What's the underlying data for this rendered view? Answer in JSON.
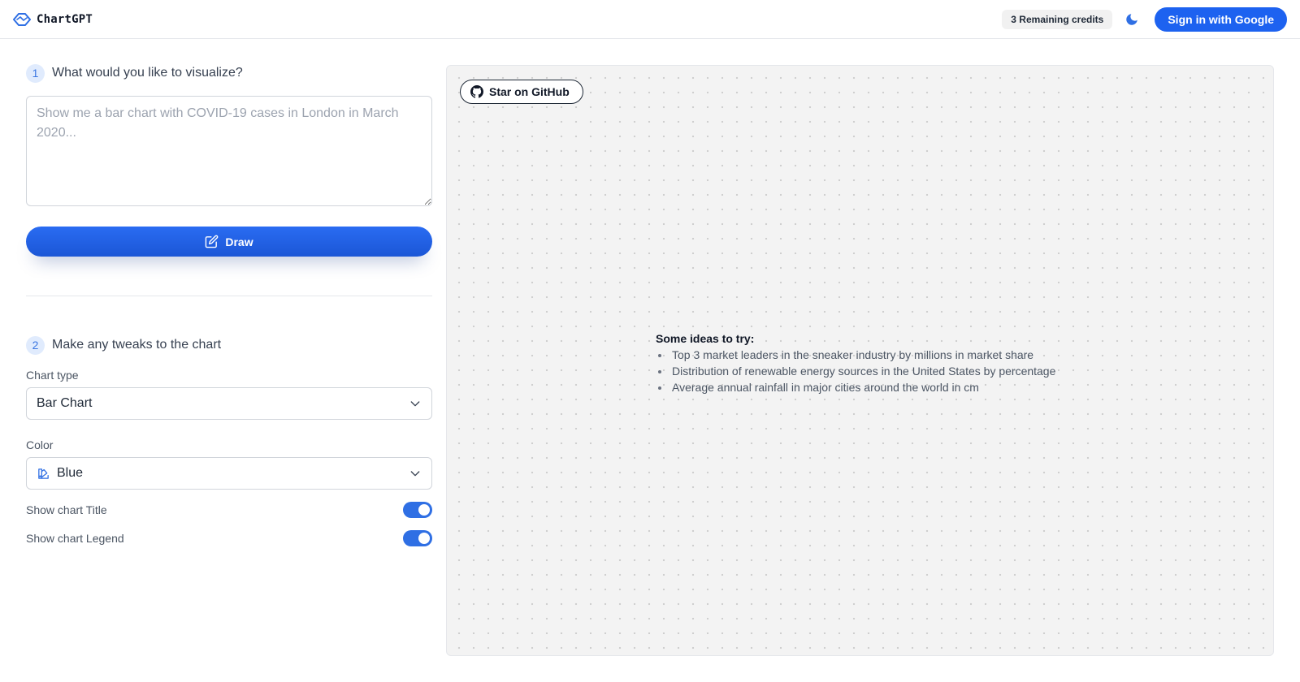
{
  "header": {
    "brand_name": "ChartGPT",
    "credits_label": "3 Remaining credits",
    "theme_icon": "moon-icon",
    "signin_label": "Sign in with Google"
  },
  "step1": {
    "number": "1",
    "title": "What would you like to visualize?",
    "prompt_value": "",
    "prompt_placeholder": "Show me a bar chart with COVID-19 cases in London in March 2020...",
    "draw_label": "Draw",
    "draw_icon": "pencil-square-icon"
  },
  "step2": {
    "number": "2",
    "title": "Make any tweaks to the chart",
    "chart_type_label": "Chart type",
    "chart_type_value": "Bar Chart",
    "color_label": "Color",
    "color_value": "Blue",
    "color_icon": "palette-icon",
    "toggles": [
      {
        "label": "Show chart Title",
        "on": true
      },
      {
        "label": "Show chart Legend",
        "on": true
      }
    ]
  },
  "canvas": {
    "github_label": "Star on GitHub",
    "ideas_title": "Some ideas to try:",
    "ideas": [
      "Top 3 market leaders in the sneaker industry by millions in market share",
      "Distribution of renewable energy sources in the United States by percentage",
      "Average annual rainfall in major cities around the world in cm"
    ]
  },
  "colors": {
    "accent": "#1d62f0",
    "toggle_on": "#2f6fe4",
    "step_badge_bg": "#e0ebfd",
    "canvas_bg": "#f3f3f3"
  }
}
